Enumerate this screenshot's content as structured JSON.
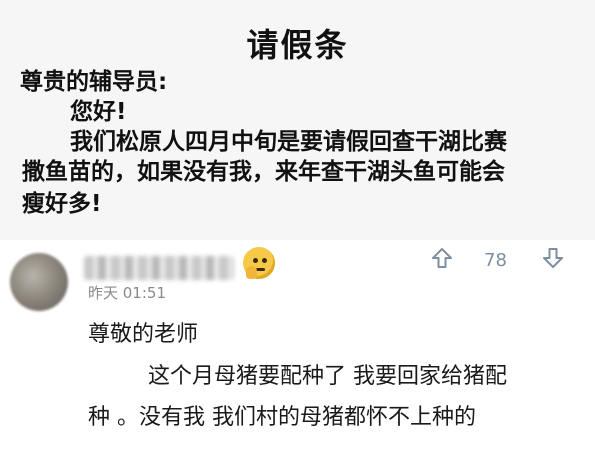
{
  "note": {
    "title": "请假条",
    "salutation": "尊贵的辅导员:",
    "greeting": "您好!",
    "body_line1": "我们松原人四月中旬是要请假回查干湖比赛",
    "body_line2": "撒鱼苗的，如果没有我，来年查干湖头鱼可能会",
    "body_line3": "瘦好多!"
  },
  "comment": {
    "avatar": "blurred-avatar",
    "username": "",
    "emoji": "thinking-face-emoji",
    "timestamp": "昨天 01:51",
    "likes": "78",
    "upvote_icon": "arrow-up-icon",
    "downvote_icon": "arrow-down-icon",
    "line1": "尊敬的老师",
    "line2": "这个月母猪要配种了 我要回家给猪配",
    "line3": "种 。没有我 我们村的母猪都怀不上种的"
  },
  "colors": {
    "vote": "#7c8fa0",
    "timestamp": "#8a8a8a"
  }
}
